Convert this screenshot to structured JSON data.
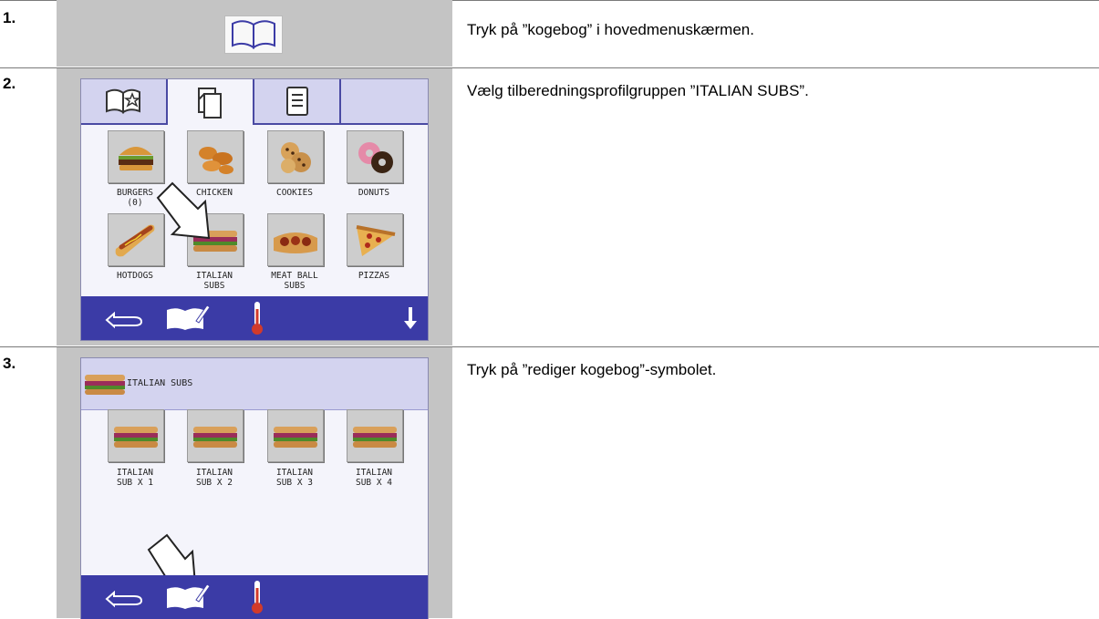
{
  "steps": [
    {
      "number": "1.",
      "instruction": "Tryk på ”kogebog” i hovedmenuskærmen."
    },
    {
      "number": "2.",
      "instruction": "Vælg tilberedningsprofilgruppen ”ITALIAN SUBS”."
    },
    {
      "number": "3.",
      "instruction": "Tryk på ”rediger kogebog”-symbolet."
    }
  ],
  "step2_screen": {
    "tabs": [
      "favorite-cookbook-icon",
      "cookbook-pages-icon",
      "document-icon"
    ],
    "groups": [
      {
        "label": "BURGERS",
        "sub": "(0)",
        "icon": "burger-icon"
      },
      {
        "label": "CHICKEN",
        "sub": "",
        "icon": "chicken-icon"
      },
      {
        "label": "COOKIES",
        "sub": "",
        "icon": "cookies-icon"
      },
      {
        "label": "DONUTS",
        "sub": "",
        "icon": "donuts-icon"
      },
      {
        "label": "HOTDOGS",
        "sub": "",
        "icon": "hotdog-icon"
      },
      {
        "label": "ITALIAN",
        "sub": "SUBS",
        "icon": "italian-sub-icon"
      },
      {
        "label": "MEAT BALL",
        "sub": "SUBS",
        "icon": "meatball-sub-icon"
      },
      {
        "label": "PIZZAS",
        "sub": "",
        "icon": "pizza-icon"
      }
    ],
    "bottom_bar": [
      "back-arrow-icon",
      "edit-cookbook-icon",
      "thermometer-icon",
      "scroll-down-icon"
    ]
  },
  "step3_screen": {
    "header": "ITALIAN SUBS",
    "recipes": [
      {
        "label": "ITALIAN",
        "sub": "SUB X 1"
      },
      {
        "label": "ITALIAN",
        "sub": "SUB X 2"
      },
      {
        "label": "ITALIAN",
        "sub": "SUB X 3"
      },
      {
        "label": "ITALIAN",
        "sub": "SUB X 4"
      }
    ],
    "bottom_bar": [
      "back-arrow-icon",
      "edit-cookbook-icon",
      "thermometer-icon"
    ]
  },
  "colors": {
    "panel": "#c4c4c4",
    "bar": "#3b3ba6",
    "tab": "#d3d3ef",
    "thermo": "#d23a2a"
  }
}
